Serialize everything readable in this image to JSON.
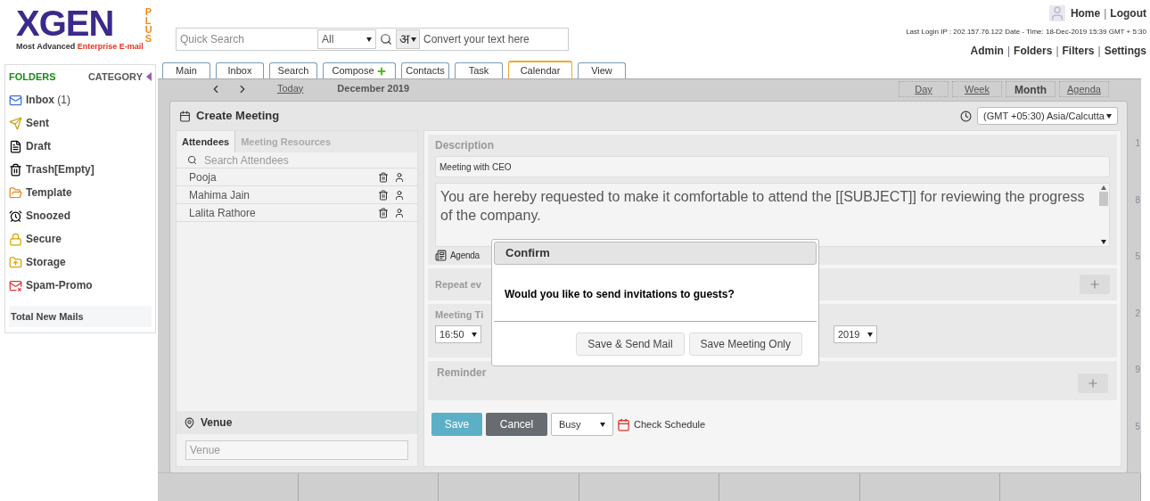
{
  "logo": {
    "name": "XGEN",
    "plus": "PLUS",
    "tagline": "Most Advanced",
    "tagline_accent": "Enterprise E-mail"
  },
  "search": {
    "placeholder": "Quick Search",
    "scope": "All",
    "script_key": "अ",
    "convert_placeholder": "Convert your text here"
  },
  "top_links": {
    "separator": "|",
    "items": [
      "Home",
      "Logout"
    ]
  },
  "last_login": "Last Login IP : 202.157.76.122 Date - Time: 18-Dec-2019 15:39 GMT + 5:30",
  "admin_links": {
    "separator": "|",
    "items": [
      "Admin",
      "Folders",
      "Filters",
      "Settings"
    ]
  },
  "sidebar": {
    "title": "FOLDERS",
    "category": "CATEGORY",
    "footer": "Total New Mails",
    "items": [
      {
        "kind": "inbox",
        "label": "Inbox",
        "count": "(1)"
      },
      {
        "kind": "sent",
        "label": "Sent"
      },
      {
        "kind": "draft",
        "label": "Draft"
      },
      {
        "kind": "trash",
        "label": "Trash[Empty]"
      },
      {
        "kind": "template",
        "label": "Template"
      },
      {
        "kind": "snoozed",
        "label": "Snoozed"
      },
      {
        "kind": "secure",
        "label": "Secure"
      },
      {
        "kind": "storage",
        "label": "Storage"
      },
      {
        "kind": "spam",
        "label": "Spam-Promo"
      }
    ]
  },
  "tabs": [
    {
      "label": "Main",
      "selected": false
    },
    {
      "label": "Inbox",
      "selected": false
    },
    {
      "label": "Search",
      "selected": false
    },
    {
      "label": "Compose",
      "selected": false,
      "add": true
    },
    {
      "label": "Contacts",
      "selected": false
    },
    {
      "label": "Task",
      "selected": false
    },
    {
      "label": "Calendar",
      "selected": true
    },
    {
      "label": "View",
      "selected": false
    }
  ],
  "calendar": {
    "today": "Today",
    "month": "December 2019",
    "views": [
      {
        "label": "Day",
        "selected": false
      },
      {
        "label": "Week",
        "selected": false
      },
      {
        "label": "Month",
        "selected": true
      },
      {
        "label": "Agenda",
        "selected": false
      }
    ],
    "edge_numbers": [
      "1",
      "8",
      "5",
      "2",
      "9",
      "5"
    ]
  },
  "meeting": {
    "title": "Create Meeting",
    "timezone": "(GMT +05:30) Asia/Calcutta",
    "panel_tabs": [
      {
        "label": "Attendees",
        "selected": true
      },
      {
        "label": "Meeting Resources",
        "selected": false
      }
    ],
    "attendee_search": "Search Attendees",
    "attendees": [
      "Pooja",
      "Mahima Jain",
      "Lalita Rathore"
    ],
    "venue_label": "Venue",
    "venue_placeholder": "Venue",
    "description_label": "Description",
    "subject": "Meeting with CEO",
    "body": "You are hereby requested to make it comfortable to attend the [[SUBJECT]] for reviewing the progress of the company.",
    "agenda": "Agenda",
    "repeat_label": "Repeat ev",
    "time_label": "Meeting Ti",
    "time": "16:50",
    "year": "2019",
    "reminder_label": "Reminder",
    "save": "Save",
    "cancel": "Cancel",
    "status": "Busy",
    "check_schedule": "Check Schedule"
  },
  "confirm": {
    "title": "Confirm",
    "message": "Would you like to send invitations to guests?",
    "buttons": [
      "Save & Send Mail",
      "Save Meeting Only"
    ]
  }
}
